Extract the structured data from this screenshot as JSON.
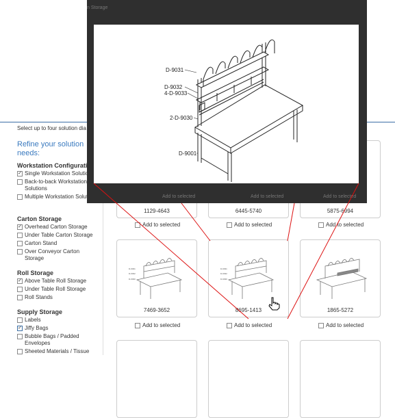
{
  "intro": "Select up to four solution dia",
  "sidebar": {
    "title": "Refine your solution needs:",
    "groups": [
      {
        "heading": "Workstation Configurati",
        "options": [
          {
            "label": "Single Workstation Solutio",
            "checked": true
          },
          {
            "label": "Back-to-back Workstation Solutions",
            "checked": false
          },
          {
            "label": "Multiple Workstation Solutions",
            "checked": false
          }
        ]
      },
      {
        "heading": "Carton Storage",
        "options": [
          {
            "label": "Overhead Carton Storage",
            "checked": true
          },
          {
            "label": "Under Table Carton Storage",
            "checked": false
          },
          {
            "label": "Carton Stand",
            "checked": false
          },
          {
            "label": "Over Conveyor Carton Storage",
            "checked": false
          }
        ]
      },
      {
        "heading": "Roll Storage",
        "options": [
          {
            "label": "Above Table Roll Storage",
            "checked": true
          },
          {
            "label": "Under Table Roll Storage",
            "checked": false
          },
          {
            "label": "Roll Stands",
            "checked": false
          }
        ]
      },
      {
        "heading": "Supply Storage",
        "options": [
          {
            "label": "Labels",
            "checked": false
          },
          {
            "label": "Jiffy Bags",
            "checked": true
          },
          {
            "label": "Bubble Bags / Padded Envelopes",
            "checked": false
          },
          {
            "label": "Sheeted Materials / Tissue",
            "checked": false
          }
        ]
      }
    ]
  },
  "cards": [
    {
      "code": "1129-4643"
    },
    {
      "code": "6445-5740"
    },
    {
      "code": "5875-6994"
    },
    {
      "code": "7469-3652"
    },
    {
      "code": "8695-1413"
    },
    {
      "code": "1865-5272"
    }
  ],
  "add_label": "Add to selected",
  "modal": {
    "labels": [
      "D-9031",
      "D-9032",
      "4-D-9033",
      "2-D-9030",
      "D-9001"
    ]
  },
  "overlay_bg_text": [
    "n Storage",
    "Add to selected",
    "Add to selected",
    "Add to selected"
  ]
}
